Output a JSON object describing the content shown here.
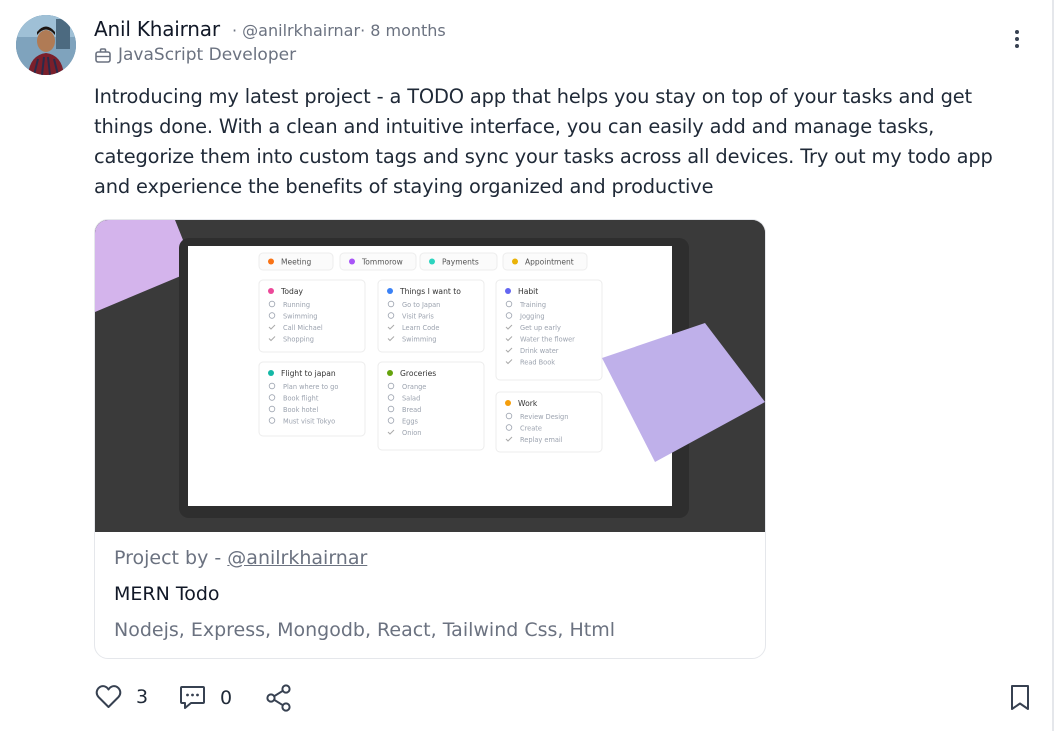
{
  "post": {
    "author": {
      "name": "Anil Khairnar",
      "meta": "· @anilrkhairnar· 8 months",
      "role": "JavaScript Developer"
    },
    "body": "Introducing my latest project - a TODO app that helps you stay on top of your tasks and get things done. With a clean and intuitive interface, you can easily add and manage tasks, categorize them into custom tags and sync your tasks across all devices. Try out my todo app and experience the benefits of staying organized and productive",
    "card": {
      "project_by_prefix": "Project by -",
      "project_by_handle": "@anilrkhairnar",
      "title": "MERN Todo",
      "tech": "Nodejs, Express, Mongodb, React, Tailwind Css, Html"
    },
    "preview": {
      "tags": [
        {
          "label": "Meeting",
          "color": "#f97316"
        },
        {
          "label": "Tommorow",
          "color": "#a855f7"
        },
        {
          "label": "Payments",
          "color": "#2dd4bf"
        },
        {
          "label": "Appointment",
          "color": "#eab308"
        }
      ],
      "lists": [
        {
          "title": "Today",
          "color": "#ec4899",
          "items": [
            "Running",
            "Swimming",
            "Call Michael",
            "Shopping"
          ]
        },
        {
          "title": "Things I want to",
          "color": "#3b82f6",
          "items": [
            "Go to Japan",
            "Visit Paris",
            "Learn Code",
            "Swimming"
          ]
        },
        {
          "title": "Habit",
          "color": "#6366f1",
          "items": [
            "Training",
            "Jogging",
            "Get up early",
            "Water the flower",
            "Drink water",
            "Read Book"
          ]
        },
        {
          "title": "Flight to japan",
          "color": "#14b8a6",
          "items": [
            "Plan where to go",
            "Book flight",
            "Book hotel",
            "Must visit Tokyo"
          ]
        },
        {
          "title": "Groceries",
          "color": "#65a30d",
          "items": [
            "Orange",
            "Salad",
            "Bread",
            "Eggs",
            "Onion"
          ]
        },
        {
          "title": "Work",
          "color": "#f59e0b",
          "items": [
            "Review Design",
            "Create",
            "Replay email"
          ]
        }
      ]
    },
    "actions": {
      "likes": "3",
      "comments": "0"
    },
    "icons": {
      "more": "more-vertical-icon",
      "like": "heart-icon",
      "comment": "comment-icon",
      "share": "share-icon",
      "bookmark": "bookmark-icon",
      "role": "briefcase-icon"
    }
  }
}
